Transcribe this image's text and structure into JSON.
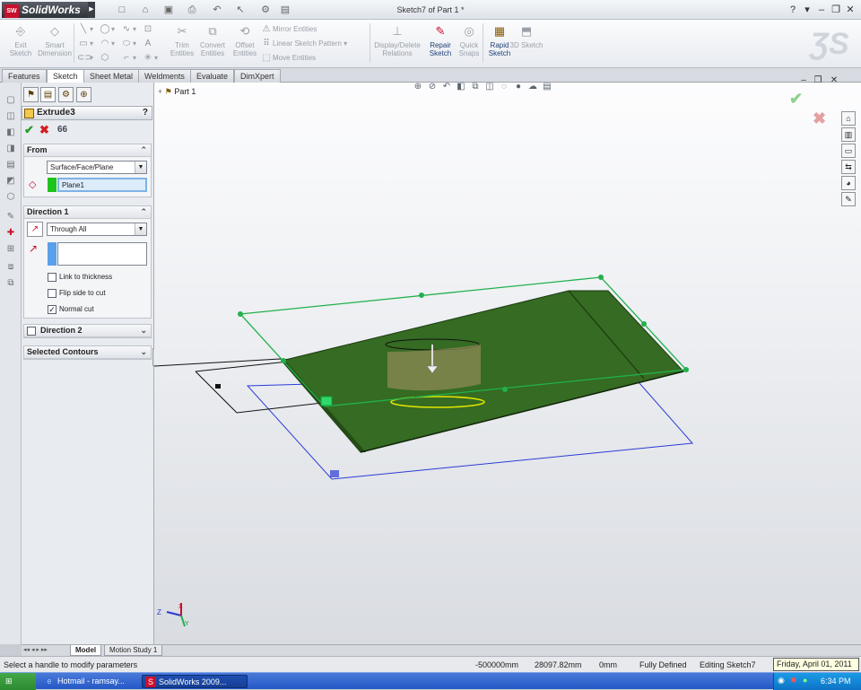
{
  "app": {
    "name": "SolidWorks",
    "badge": "SW",
    "doc_title": "Sketch7 of Part 1 *"
  },
  "quick_access": [
    "new-icon",
    "open-icon",
    "save-icon",
    "print-icon",
    "undo-icon",
    "select-icon",
    "rebuild-icon",
    "options-icon"
  ],
  "window_controls": {
    "help": "?",
    "menu": "▾",
    "minimize": "–",
    "restore": "❐",
    "close": "✕"
  },
  "ribbon": {
    "exit_sketch": "Exit Sketch",
    "smart_dimension": "Smart Dimension",
    "trim_entities": "Trim Entities",
    "convert_entities": "Convert Entities",
    "offset_entities": "Offset Entities",
    "mirror_entities": "Mirror Entities",
    "linear_sketch_pattern": "Linear Sketch Pattern",
    "move_entities": "Move Entities",
    "display_delete_relations": "Display/Delete Relations",
    "repair_sketch": "Repair Sketch",
    "quick_snaps": "Quick Snaps",
    "rapid_sketch": "Rapid Sketch",
    "sketch_3d": "3D Sketch"
  },
  "tabs": [
    "Features",
    "Sketch",
    "Sheet Metal",
    "Weldments",
    "Evaluate",
    "DimXpert"
  ],
  "active_tab": "Sketch",
  "property_manager": {
    "feature_name": "Extrude3",
    "help": "?",
    "from": {
      "header": "From",
      "start_condition": "Surface/Face/Plane",
      "selection": "Plane1"
    },
    "direction1": {
      "header": "Direction 1",
      "end_condition": "Through All",
      "link_to_thickness": "Link to thickness",
      "flip_side_to_cut": "Flip side to cut",
      "normal_cut": "Normal cut",
      "link_checked": false,
      "flip_checked": false,
      "normal_checked": true
    },
    "direction2": {
      "header": "Direction 2",
      "checked": false
    },
    "selected_contours": {
      "header": "Selected Contours"
    }
  },
  "tree": {
    "root": "Part 1"
  },
  "triad": {
    "x": "X",
    "y": "Y",
    "z": "Z"
  },
  "model_tabs": [
    "Model",
    "Motion Study 1"
  ],
  "status": {
    "message": "Select a handle to modify parameters",
    "x": "-500000mm",
    "y": "28097.82mm",
    "z": "0mm",
    "state": "Fully Defined",
    "editing": "Editing Sketch7"
  },
  "tooltip": "Friday, April 01, 2011",
  "taskbar": {
    "apps": [
      "Hotmail - ramsay...",
      "SolidWorks 2009..."
    ],
    "clock": "6:34 PM"
  },
  "colors": {
    "sheet": "#356b22",
    "plane_outline": "#22b14c",
    "sketch_blue": "#2b3bd6",
    "highlight_yellow": "#e6e600"
  }
}
